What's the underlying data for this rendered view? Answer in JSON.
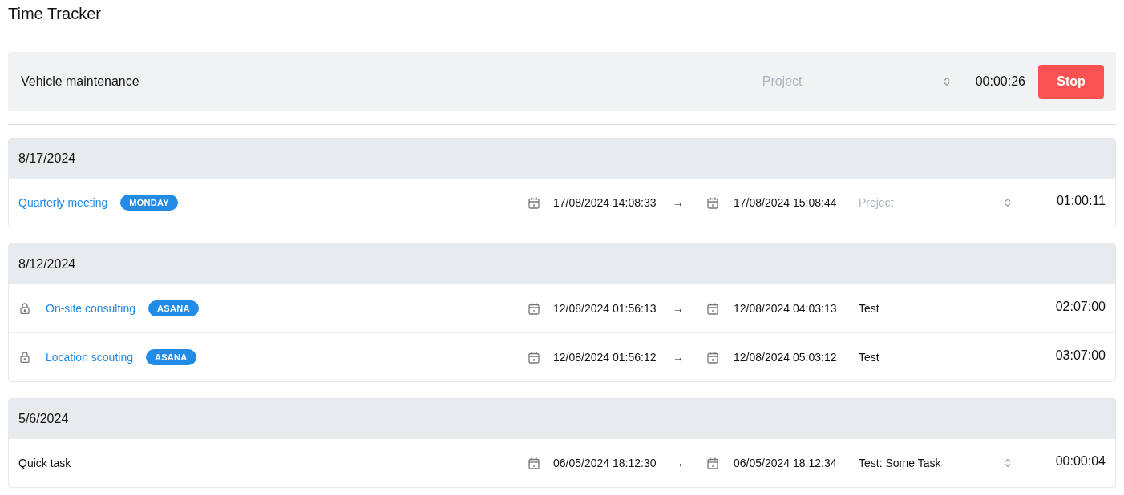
{
  "header": {
    "title": "Time Tracker"
  },
  "timer": {
    "description": "Vehicle maintenance",
    "project_placeholder": "Project",
    "elapsed": "00:00:26",
    "button": "Stop"
  },
  "groups": [
    {
      "date": "8/17/2024",
      "entries": [
        {
          "description": "Quarterly meeting",
          "kind": "link",
          "locked": false,
          "badge": "MONDAY",
          "start": "17/08/2024 14:08:33",
          "arrow": "→",
          "end": "17/08/2024 15:08:44",
          "project_placeholder": "Project",
          "duration": "01:00:11"
        }
      ]
    },
    {
      "date": "8/12/2024",
      "entries": [
        {
          "description": "On-site consulting",
          "kind": "link",
          "locked": true,
          "badge": "ASANA",
          "start": "12/08/2024 01:56:13",
          "arrow": "→",
          "end": "12/08/2024 04:03:13",
          "project": "Test",
          "duration": "02:07:00"
        },
        {
          "description": "Location scouting",
          "kind": "link",
          "locked": true,
          "badge": "ASANA",
          "start": "12/08/2024 01:56:12",
          "arrow": "→",
          "end": "12/08/2024 05:03:12",
          "project": "Test",
          "duration": "03:07:00"
        }
      ]
    },
    {
      "date": "5/6/2024",
      "entries": [
        {
          "description": "Quick task",
          "kind": "plain",
          "locked": false,
          "start": "06/05/2024 18:12:30",
          "arrow": "→",
          "end": "06/05/2024 18:12:34",
          "project": "Test: Some Task",
          "duration": "00:00:04"
        }
      ]
    }
  ]
}
